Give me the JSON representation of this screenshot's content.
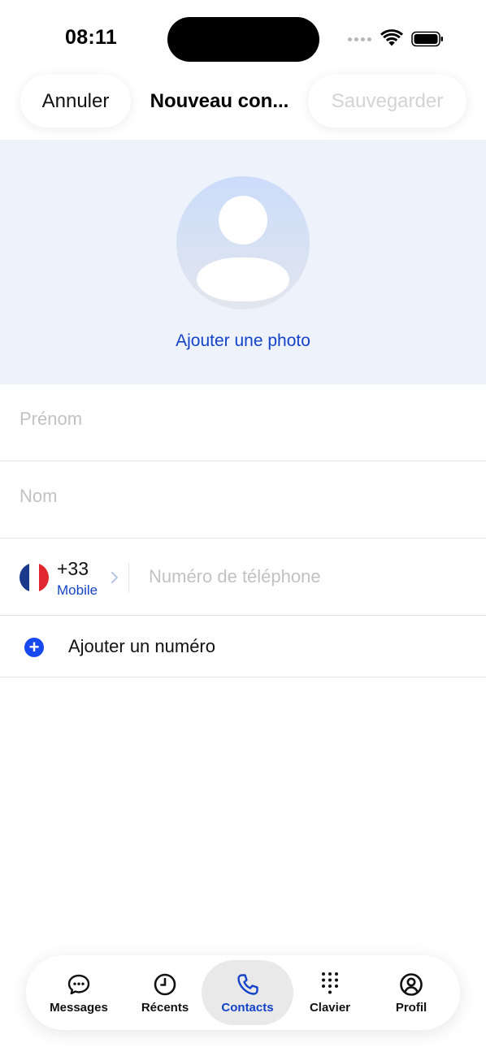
{
  "status_bar": {
    "time": "08:11"
  },
  "header": {
    "cancel_label": "Annuler",
    "title": "Nouveau con...",
    "save_label": "Sauvegarder"
  },
  "photo": {
    "add_photo_label": "Ajouter une photo"
  },
  "form": {
    "first_name": {
      "placeholder": "Prénom",
      "value": ""
    },
    "last_name": {
      "placeholder": "Nom",
      "value": ""
    },
    "phone": {
      "country_flag": "france-flag-icon",
      "country_code": "+33",
      "type": "Mobile",
      "placeholder": "Numéro de téléphone",
      "value": ""
    },
    "add_number_label": "Ajouter un numéro"
  },
  "tab_bar": {
    "active": "Contacts",
    "tabs": [
      {
        "label": "Messages",
        "icon": "chat-bubble-icon"
      },
      {
        "label": "Récents",
        "icon": "clock-icon"
      },
      {
        "label": "Contacts",
        "icon": "phone-icon"
      },
      {
        "label": "Clavier",
        "icon": "keypad-icon"
      },
      {
        "label": "Profil",
        "icon": "profile-icon"
      }
    ]
  },
  "colors": {
    "accent": "#1443c8",
    "add_button": "#1649f0",
    "photo_background": "#edf2fb",
    "placeholder": "#c2c2c2",
    "disabled": "#d3d3d3"
  }
}
